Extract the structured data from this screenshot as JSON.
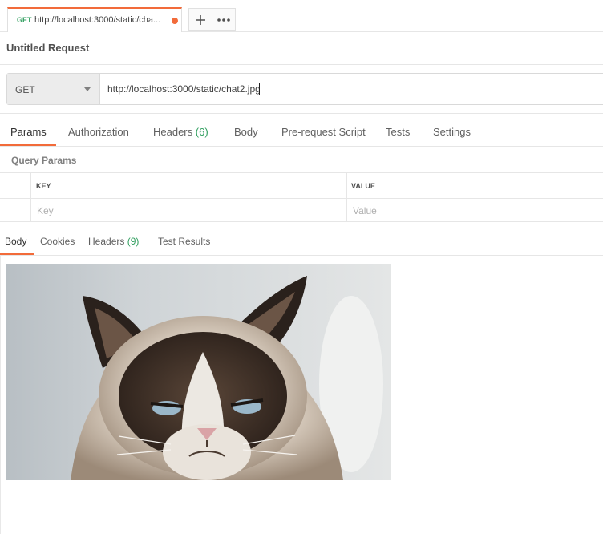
{
  "tab": {
    "method": "GET",
    "url": "http://localhost:3000/static/cha...",
    "dirty_color": "#f26b3a"
  },
  "tab_buttons": {
    "add_icon": "plus-icon",
    "more_icon": "ellipsis-icon"
  },
  "request": {
    "name": "Untitled Request",
    "method": "GET",
    "url": "http://localhost:3000/static/chat2.jpg"
  },
  "request_tabs": [
    {
      "label": "Params",
      "count": ""
    },
    {
      "label": "Authorization",
      "count": ""
    },
    {
      "label": "Headers",
      "count": "(6)"
    },
    {
      "label": "Body",
      "count": ""
    },
    {
      "label": "Pre-request Script",
      "count": ""
    },
    {
      "label": "Tests",
      "count": ""
    },
    {
      "label": "Settings",
      "count": ""
    }
  ],
  "query_params": {
    "title": "Query Params",
    "columns": [
      "KEY",
      "VALUE"
    ],
    "placeholders": [
      "Key",
      "Value"
    ]
  },
  "response_tabs": [
    {
      "label": "Body",
      "count": ""
    },
    {
      "label": "Cookies",
      "count": ""
    },
    {
      "label": "Headers",
      "count": "(9)"
    },
    {
      "label": "Test Results",
      "count": ""
    }
  ],
  "colors": {
    "accent": "#f26b3a",
    "method_green": "#2f9e5e"
  }
}
